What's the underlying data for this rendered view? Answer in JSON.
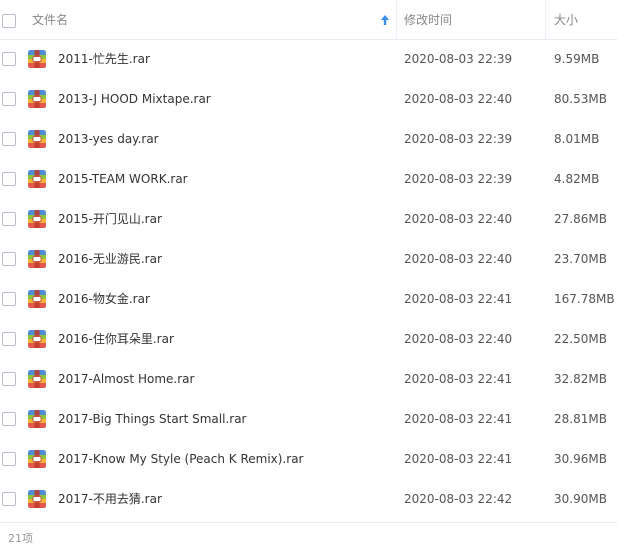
{
  "header": {
    "name_label": "文件名",
    "time_label": "修改时间",
    "size_label": "大小"
  },
  "rows": [
    {
      "name": "2011-忙先生.rar",
      "time": "2020-08-03 22:39",
      "size": "9.59MB"
    },
    {
      "name": "2013-J HOOD Mixtape.rar",
      "time": "2020-08-03 22:40",
      "size": "80.53MB"
    },
    {
      "name": "2013-yes day.rar",
      "time": "2020-08-03 22:39",
      "size": "8.01MB"
    },
    {
      "name": "2015-TEAM WORK.rar",
      "time": "2020-08-03 22:39",
      "size": "4.82MB"
    },
    {
      "name": "2015-开门见山.rar",
      "time": "2020-08-03 22:40",
      "size": "27.86MB"
    },
    {
      "name": "2016-无业游民.rar",
      "time": "2020-08-03 22:40",
      "size": "23.70MB"
    },
    {
      "name": "2016-物女金.rar",
      "time": "2020-08-03 22:41",
      "size": "167.78MB"
    },
    {
      "name": "2016-住你耳朵里.rar",
      "time": "2020-08-03 22:40",
      "size": "22.50MB"
    },
    {
      "name": "2017-Almost Home.rar",
      "time": "2020-08-03 22:41",
      "size": "32.82MB"
    },
    {
      "name": "2017-Big Things Start Small.rar",
      "time": "2020-08-03 22:41",
      "size": "28.81MB"
    },
    {
      "name": "2017-Know My Style (Peach K Remix).rar",
      "time": "2020-08-03 22:41",
      "size": "30.96MB"
    },
    {
      "name": "2017-不用去猜.rar",
      "time": "2020-08-03 22:42",
      "size": "30.90MB"
    }
  ],
  "footer": {
    "count": "21项"
  },
  "icons": {
    "header_checkbox": "checkbox-icon",
    "sort": "sort-ascending-icon",
    "file": "rar-archive-icon"
  },
  "colors": {
    "sort_arrow": "#3a8ee6",
    "archive_top": "#4f8fd6",
    "archive_mid": "#8cc63e",
    "archive_low": "#f0b23a",
    "archive_bottom": "#e5584e",
    "archive_band": "#c0392b"
  }
}
